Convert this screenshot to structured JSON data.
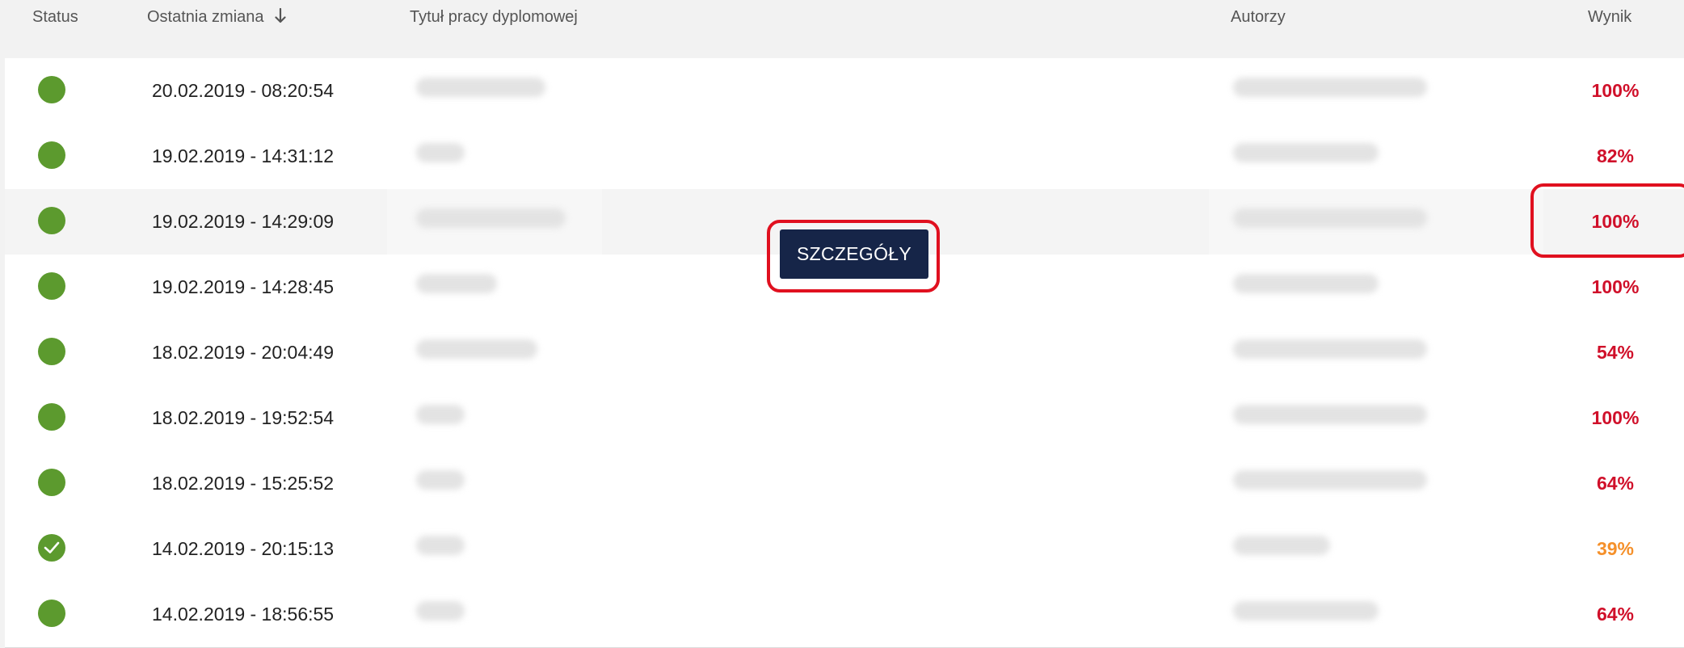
{
  "header": {
    "status": "Status",
    "last_change": "Ostatnia zmiana",
    "thesis_title": "Tytuł pracy dyplomowej",
    "authors": "Autorzy",
    "score": "Wynik"
  },
  "details_button": "SZCZEGÓŁY",
  "colors": {
    "score_red": "#d0102a",
    "score_orange": "#f5902a",
    "status_green": "#5c9a2e",
    "button_navy": "#162548",
    "highlight_red": "#e0101f"
  },
  "rows": [
    {
      "status": "green-dot",
      "date": "20.02.2019 - 08:20:54",
      "title": "",
      "authors": "",
      "score": "100%",
      "score_color": "red"
    },
    {
      "status": "green-dot",
      "date": "19.02.2019 - 14:31:12",
      "title": "",
      "authors": "",
      "score": "82%",
      "score_color": "red"
    },
    {
      "status": "green-dot",
      "date": "19.02.2019 - 14:29:09",
      "title": "",
      "authors": "",
      "score": "100%",
      "score_color": "red"
    },
    {
      "status": "green-dot",
      "date": "19.02.2019 - 14:28:45",
      "title": "",
      "authors": "",
      "score": "100%",
      "score_color": "red"
    },
    {
      "status": "green-dot",
      "date": "18.02.2019 - 20:04:49",
      "title": "",
      "authors": "",
      "score": "54%",
      "score_color": "red"
    },
    {
      "status": "green-dot",
      "date": "18.02.2019 - 19:52:54",
      "title": "",
      "authors": "",
      "score": "100%",
      "score_color": "red"
    },
    {
      "status": "green-dot",
      "date": "18.02.2019 - 15:25:52",
      "title": "",
      "authors": "",
      "score": "64%",
      "score_color": "red"
    },
    {
      "status": "check-icon",
      "date": "14.02.2019 - 20:15:13",
      "title": "",
      "authors": "",
      "score": "39%",
      "score_color": "orange"
    },
    {
      "status": "green-dot",
      "date": "14.02.2019 - 18:56:55",
      "title": "",
      "authors": "",
      "score": "64%",
      "score_color": "red"
    }
  ]
}
